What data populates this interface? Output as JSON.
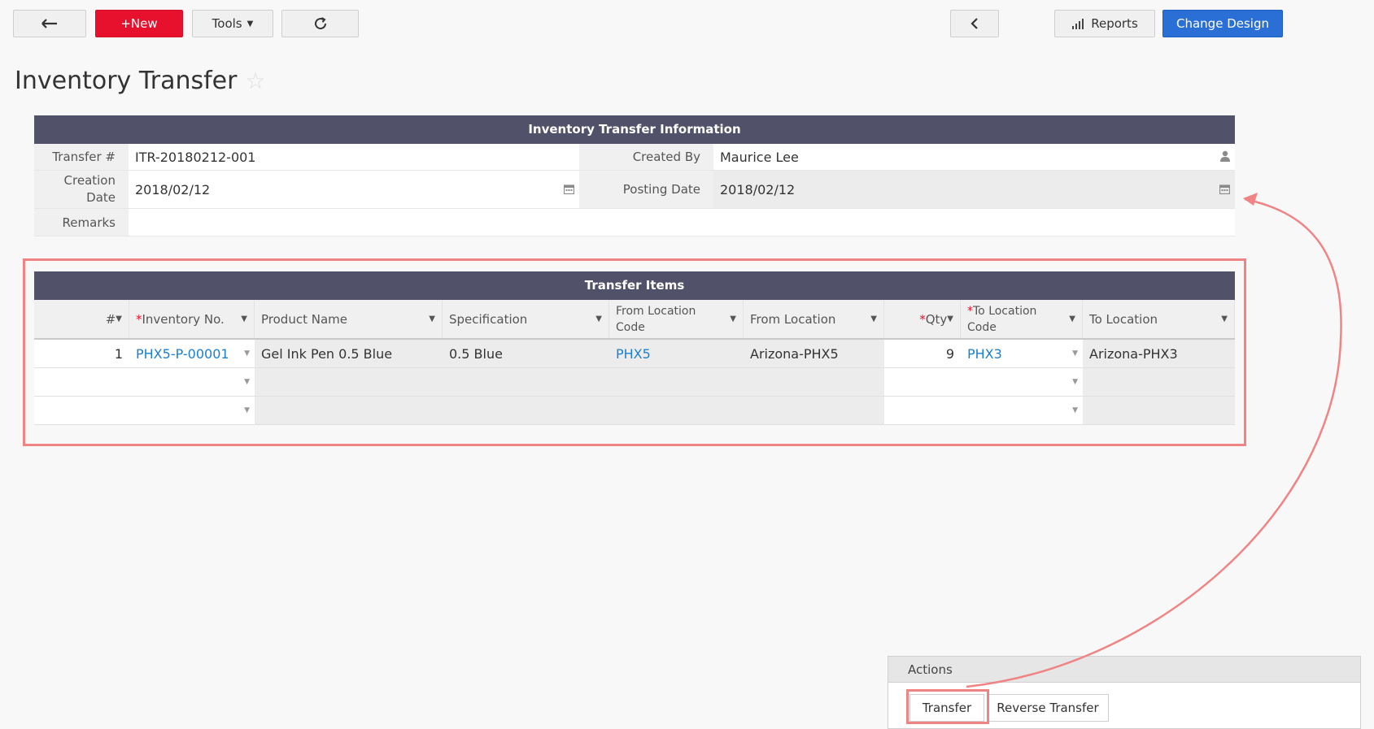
{
  "toolbar": {
    "back_icon": "arrow-left-icon",
    "new_label": "+New",
    "tools_label": "Tools",
    "refresh_icon": "refresh-icon",
    "prev_icon": "chevron-left-icon",
    "reports_label": "Reports",
    "change_design_label": "Change Design"
  },
  "page": {
    "title": "Inventory Transfer"
  },
  "info": {
    "header": "Inventory Transfer Information",
    "transfer_label": "Transfer #",
    "transfer_value": "ITR-20180212-001",
    "created_by_label": "Created By",
    "created_by_value": "Maurice Lee",
    "creation_date_label_1": "Creation",
    "creation_date_label_2": "Date",
    "creation_date_value": "2018/02/12",
    "posting_date_label": "Posting Date",
    "posting_date_value": "2018/02/12",
    "remarks_label": "Remarks",
    "remarks_value": ""
  },
  "items": {
    "header": "Transfer Items",
    "columns": {
      "num": "#",
      "inventory_no": "Inventory No.",
      "product_name": "Product Name",
      "specification": "Specification",
      "from_location_code_1": "From Location",
      "from_location_code_2": "Code",
      "from_location": "From Location",
      "qty": "Qty",
      "to_location_code_1": "To Location",
      "to_location_code_2": "Code",
      "to_location": "To Location"
    },
    "rows": [
      {
        "num": "1",
        "inventory_no": "PHX5-P-00001",
        "product_name": "Gel Ink Pen 0.5 Blue",
        "specification": "0.5 Blue",
        "from_location_code": "PHX5",
        "from_location": "Arizona-PHX5",
        "qty": "9",
        "to_location_code": "PHX3",
        "to_location": "Arizona-PHX3"
      }
    ]
  },
  "actions": {
    "header": "Actions",
    "transfer_label": "Transfer",
    "reverse_transfer_label": "Reverse Transfer"
  },
  "colors": {
    "primary_red": "#e8112d",
    "primary_blue": "#2a6fd6",
    "section_header": "#52516a",
    "link": "#1a7fd1",
    "highlight": "#f08484"
  }
}
